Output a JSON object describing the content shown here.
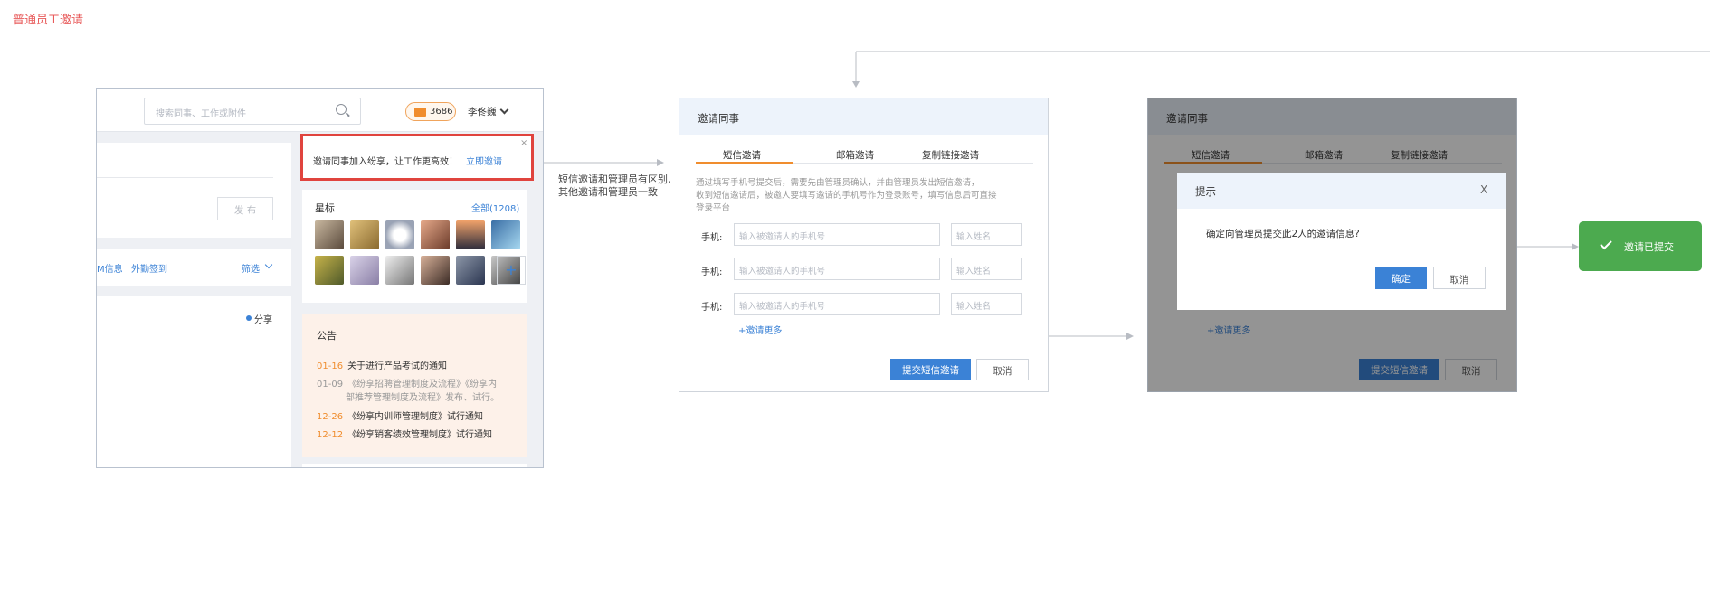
{
  "page_label": "普通员工邀请",
  "app": {
    "search_placeholder": "搜索同事、工作或附件",
    "message_count": "3686",
    "user_name": "李佟巍",
    "publish_label": "发 布",
    "left_links": [
      "M信息",
      "外勤签到"
    ],
    "filter_label": "筛选",
    "share_label": "分享",
    "invite_banner": {
      "text": "邀请同事加入纷享，让工作更高效！",
      "link": "立即邀请",
      "close": "×"
    },
    "starred": {
      "title": "星标",
      "all_link": "全部(1208)",
      "add": "+"
    },
    "notice": {
      "title": "公告",
      "items": [
        {
          "date": "01-16",
          "text": "关于进行产品考试的通知"
        },
        {
          "date": "01-09",
          "text": "《纷享招聘管理制度及流程》《纷享内",
          "text2": "部推荐管理制度及流程》发布、试行。"
        },
        {
          "date": "12-26",
          "text": "《纷享内训师管理制度》试行通知"
        },
        {
          "date": "12-12",
          "text": "《纷享销客绩效管理制度》试行通知"
        }
      ]
    }
  },
  "annotation": [
    "短信邀请和管理员有区别,",
    "其他邀请和管理员一致"
  ],
  "invite_dialog": {
    "title": "邀请同事",
    "tabs": [
      "短信邀请",
      "邮箱邀请",
      "复制链接邀请"
    ],
    "description": [
      "通过填写手机号提交后，需要先由管理员确认，并由管理员发出短信邀请，",
      "收到短信邀请后，被邀人要填写邀请的手机号作为登录账号，填写信息后可直接",
      "登录平台"
    ],
    "phone_label": "手机:",
    "phone_placeholder": "输入被邀请人的手机号",
    "name_placeholder": "输入姓名",
    "more_link": "+邀请更多",
    "submit": "提交短信邀请",
    "cancel": "取消"
  },
  "confirm_dialog": {
    "title": "提示",
    "close": "X",
    "message": "确定向管理员提交此2人的邀请信息?",
    "ok": "确定",
    "cancel": "取消"
  },
  "toast": {
    "text": "邀请已提交"
  },
  "colors": {
    "accent": "#3b82d6",
    "tab_active": "#f08d2e",
    "highlight": "#e0443e",
    "success": "#4caa4f",
    "page_label": "#e85b5b"
  }
}
